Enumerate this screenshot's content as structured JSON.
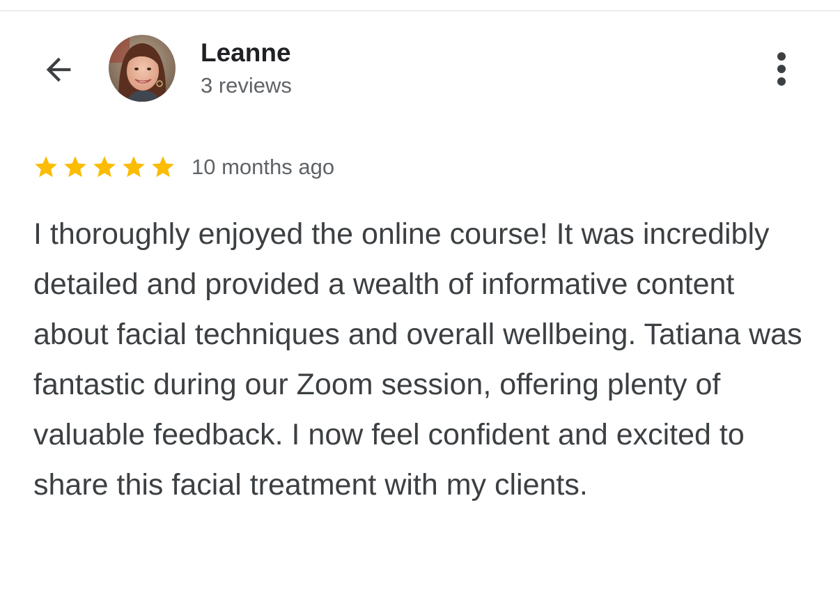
{
  "header": {
    "reviewer_name": "Leanne",
    "review_count": "3 reviews",
    "back_icon": "arrow-left-icon",
    "more_icon": "more-vertical-icon"
  },
  "review": {
    "rating": 5,
    "rating_max": 5,
    "star_color": "#fbbc04",
    "date": "10 months ago",
    "text": "I thoroughly enjoyed the online course! It was incredibly detailed and provided a wealth of informative content about facial techniques and overall wellbeing. Tatiana was fantastic during our Zoom session, offering plenty of valuable feedback. I now feel confident and excited to share this facial treatment with my clients."
  }
}
